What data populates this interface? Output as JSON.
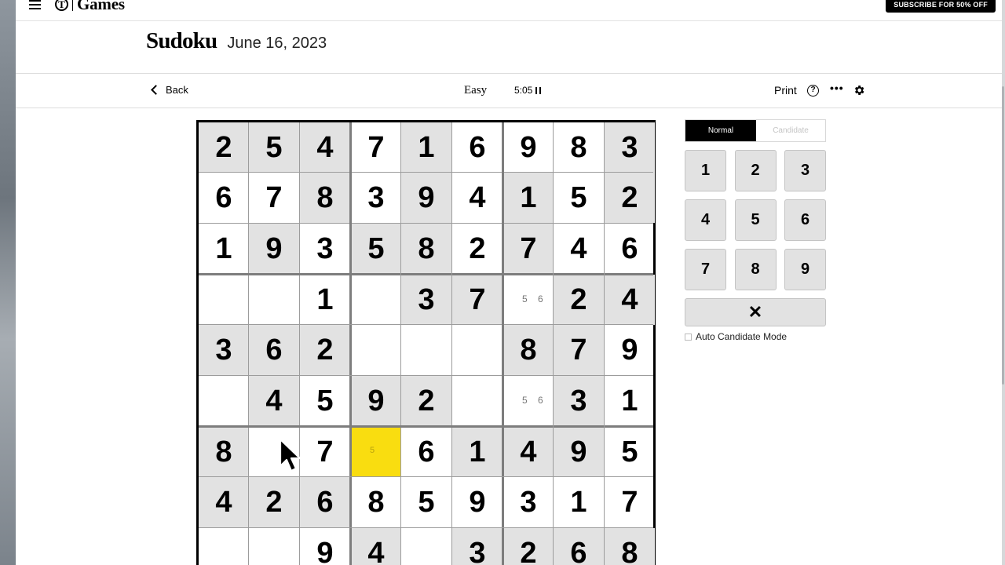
{
  "header": {
    "logo_mark": "T",
    "logo_text": "Games",
    "subscribe_label": "SUBSCRIBE FOR 50% OFF"
  },
  "title": {
    "game": "Sudoku",
    "date": "June 16, 2023"
  },
  "toolbar": {
    "back_label": "Back",
    "difficulty": "Easy",
    "timer": "5:05",
    "print_label": "Print",
    "help_glyph": "?",
    "more_glyph": "•••"
  },
  "board": {
    "rows": [
      [
        "2",
        "5",
        "4",
        "7",
        "1",
        "6",
        "9",
        "8",
        "3"
      ],
      [
        "6",
        "7",
        "8",
        "3",
        "9",
        "4",
        "1",
        "5",
        "2"
      ],
      [
        "1",
        "9",
        "3",
        "5",
        "8",
        "2",
        "7",
        "4",
        "6"
      ],
      [
        "",
        "",
        "1",
        "",
        "3",
        "7",
        "",
        "2",
        "4"
      ],
      [
        "3",
        "6",
        "2",
        "",
        "",
        "",
        "8",
        "7",
        "9"
      ],
      [
        "",
        "4",
        "5",
        "9",
        "2",
        "",
        "",
        "3",
        "1"
      ],
      [
        "8",
        "",
        "7",
        "",
        "6",
        "1",
        "4",
        "9",
        "5"
      ],
      [
        "4",
        "2",
        "6",
        "8",
        "5",
        "9",
        "3",
        "1",
        "7"
      ],
      [
        "",
        "",
        "9",
        "4",
        "",
        "3",
        "2",
        "6",
        "8"
      ]
    ],
    "shaded": [
      [
        1,
        1,
        1,
        0,
        1,
        0,
        0,
        0,
        1
      ],
      [
        0,
        0,
        1,
        0,
        1,
        0,
        1,
        0,
        1
      ],
      [
        0,
        1,
        0,
        1,
        1,
        0,
        1,
        0,
        0
      ],
      [
        0,
        0,
        0,
        0,
        1,
        1,
        0,
        1,
        1
      ],
      [
        1,
        1,
        1,
        0,
        0,
        0,
        1,
        1,
        0
      ],
      [
        0,
        1,
        0,
        1,
        1,
        0,
        0,
        1,
        0
      ],
      [
        1,
        0,
        0,
        0,
        0,
        1,
        1,
        1,
        0
      ],
      [
        1,
        1,
        1,
        0,
        0,
        0,
        0,
        0,
        0
      ],
      [
        0,
        0,
        0,
        1,
        0,
        1,
        1,
        1,
        1
      ]
    ],
    "candidates": [
      {
        "row": 3,
        "col": 6,
        "values": [
          "5",
          "6"
        ]
      },
      {
        "row": 5,
        "col": 6,
        "values": [
          "5",
          "6"
        ]
      },
      {
        "row": 6,
        "col": 3,
        "values": [
          "5"
        ]
      }
    ],
    "selected": {
      "row": 6,
      "col": 3
    },
    "colors": {
      "shade": "#e2e2e2",
      "selected": "#f9dd10"
    }
  },
  "keypad": {
    "mode_normal": "Normal",
    "mode_candidate": "Candidate",
    "active_mode": "Normal",
    "keys": [
      "1",
      "2",
      "3",
      "4",
      "5",
      "6",
      "7",
      "8",
      "9"
    ],
    "erase_glyph": "✕",
    "auto_candidate_label": "Auto Candidate Mode",
    "auto_candidate_checked": false
  },
  "icons": {
    "menu": "hamburger-icon",
    "back": "chevron-left-icon",
    "pause": "pause-icon",
    "help": "help-icon",
    "more": "more-icon",
    "settings": "gear-icon",
    "erase": "close-icon",
    "cursor": "mouse-pointer-icon"
  }
}
